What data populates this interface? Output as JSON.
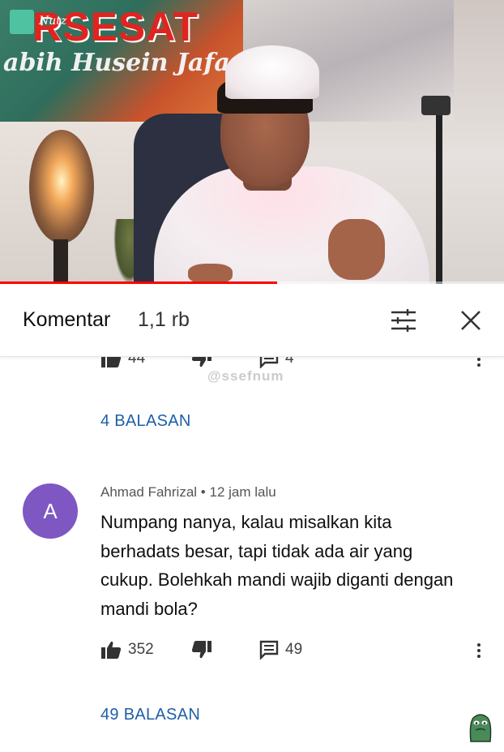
{
  "video": {
    "banner_title": "RSESAT",
    "banner_subtitle": "abih Husein Jafar",
    "channel_logo_text": "Nutz",
    "progress_fraction": 0.55,
    "colors": {
      "progress": "#ff0000"
    }
  },
  "comments_header": {
    "title": "Komentar",
    "count": "1,1 rb",
    "sort_icon": "tune-icon",
    "close_icon": "close-icon"
  },
  "previous_comment": {
    "likes": "44",
    "replies_count": "4",
    "replies_label": "4 BALASAN"
  },
  "watermark": "@ssefnum",
  "comment": {
    "avatar_letter": "A",
    "author": "Ahmad Fahrizal",
    "separator": "•",
    "time": "12 jam lalu",
    "text": "Numpang nanya, kalau misalkan kita berhadats besar, tapi tidak ada air yang cukup. Bolehkah mandi wajib diganti dengan mandi bola?",
    "likes": "352",
    "replies_count": "49",
    "replies_label": "49 BALASAN",
    "colors": {
      "avatar": "#7e57c2",
      "replies_link": "#1d5fa8"
    }
  }
}
